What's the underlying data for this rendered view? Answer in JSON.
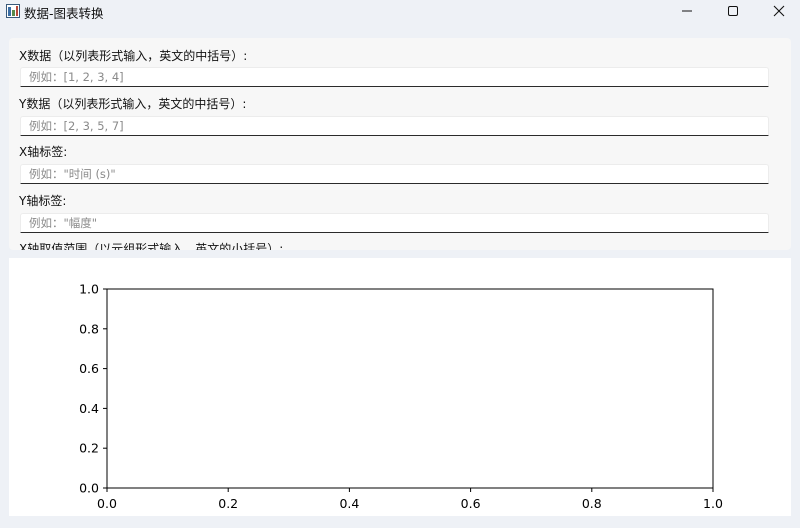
{
  "window": {
    "title": "数据-图表转换",
    "controls": {
      "minimize": "minimize-icon",
      "maximize": "maximize-icon",
      "close": "close-icon"
    }
  },
  "form": {
    "fields": [
      {
        "label": "X数据（以列表形式输入，英文的中括号）:",
        "placeholder": "例如：[1, 2, 3, 4]",
        "value": ""
      },
      {
        "label": "Y数据（以列表形式输入，英文的中括号）:",
        "placeholder": "例如：[2, 3, 5, 7]",
        "value": ""
      },
      {
        "label": "X轴标签:",
        "placeholder": "例如：\"时间 (s)\"",
        "value": ""
      },
      {
        "label": "Y轴标签:",
        "placeholder": "例如：\"幅度\"",
        "value": ""
      },
      {
        "label": "X轴取值范围（以元组形式输入，英文的小括号）:",
        "placeholder": "",
        "value": ""
      }
    ]
  },
  "chart_data": {
    "type": "line",
    "x": [],
    "series": [],
    "xlim": [
      0.0,
      1.0
    ],
    "ylim": [
      0.0,
      1.0
    ],
    "xticks": [
      "0.0",
      "0.2",
      "0.4",
      "0.6",
      "0.8",
      "1.0"
    ],
    "yticks": [
      "0.0",
      "0.2",
      "0.4",
      "0.6",
      "0.8",
      "1.0"
    ],
    "title": "",
    "xlabel": "",
    "ylabel": "",
    "grid": false
  }
}
